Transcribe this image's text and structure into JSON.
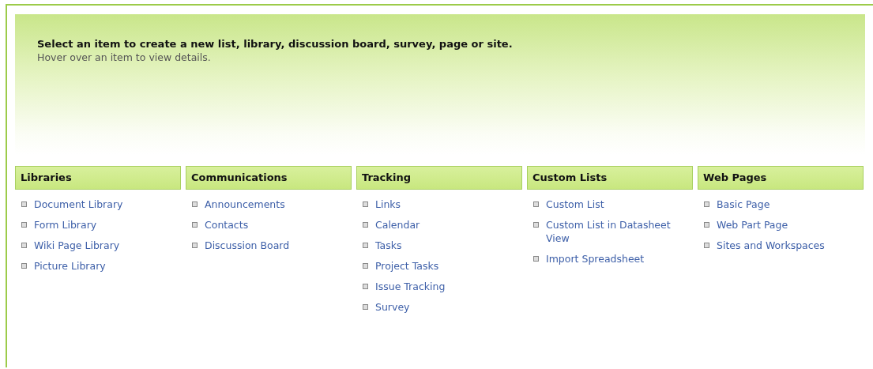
{
  "banner": {
    "title": "Select an item to create a new list, library, discussion board, survey, page or site.",
    "subtitle": "Hover over an item to view details."
  },
  "categories": [
    {
      "heading": "Libraries",
      "items": [
        "Document Library",
        "Form Library",
        "Wiki Page Library",
        "Picture Library"
      ]
    },
    {
      "heading": "Communications",
      "items": [
        "Announcements",
        "Contacts",
        "Discussion Board"
      ]
    },
    {
      "heading": "Tracking",
      "items": [
        "Links",
        "Calendar",
        "Tasks",
        "Project Tasks",
        "Issue Tracking",
        "Survey"
      ]
    },
    {
      "heading": "Custom Lists",
      "items": [
        "Custom List",
        "Custom List in Datasheet View",
        "Import Spreadsheet"
      ]
    },
    {
      "heading": "Web Pages",
      "items": [
        "Basic Page",
        "Web Part Page",
        "Sites and Workspaces"
      ]
    }
  ]
}
